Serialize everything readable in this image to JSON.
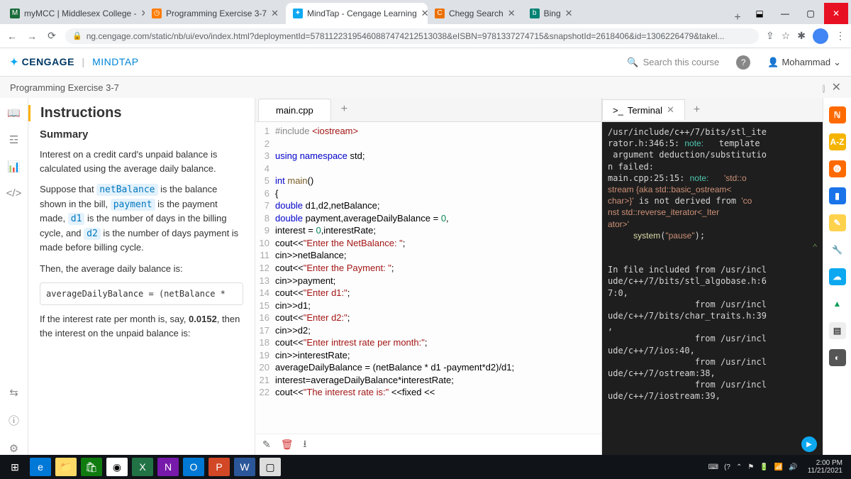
{
  "browser": {
    "tabs": [
      {
        "fav": "M",
        "favbg": "#1a6b3a",
        "label": "myMCC | Middlesex College - "
      },
      {
        "fav": "◷",
        "favbg": "#ff7b00",
        "label": "Programming Exercise 3-7"
      },
      {
        "fav": "✦",
        "favbg": "#0da8f0",
        "label": "MindTap - Cengage Learning",
        "active": true
      },
      {
        "fav": "C",
        "favbg": "#eb7100",
        "label": "Chegg Search"
      },
      {
        "fav": "b",
        "favbg": "#008373",
        "label": "Bing"
      }
    ],
    "url": "ng.cengage.com/static/nb/ui/evo/index.html?deploymentId=57811223195460887474212513038&eISBN=9781337274715&snapshotId=2618406&id=1306226479&takel..."
  },
  "cengage": {
    "brand1": "CENGAGE",
    "brand2": "MINDTAP",
    "search_placeholder": "Search this course",
    "user": "Mohammad"
  },
  "subheader": {
    "title": "Programming Exercise 3-7"
  },
  "instructions": {
    "title": "Instructions",
    "summary_h": "Summary",
    "p1": "Interest on a credit card's unpaid balance is calculated using the average daily balance.",
    "p2a": "Suppose that ",
    "p2b": " is the balance shown in the bill, ",
    "p2c": " is the payment made, ",
    "p2d": " is the number of days in the billing cycle, and ",
    "p2e": " is the number of days payment is made before billing cycle.",
    "code_net": "netBalance",
    "code_pay": "payment",
    "code_d1": "d1",
    "code_d2": "d2",
    "p3": "Then, the average daily balance is:",
    "box1": "averageDailyBalance = (netBalance *",
    "p4a": "If the interest rate per month is, say, ",
    "p4b": ", then the interest on the unpaid balance is:",
    "rate": "0.0152",
    "book_icon": "📖"
  },
  "editor": {
    "tab": "main.cpp",
    "lines": [
      {
        "n": 1,
        "html": "<span class='pp'>#include</span> <span class='str'>&lt;iostream&gt;</span>"
      },
      {
        "n": 2,
        "html": ""
      },
      {
        "n": 3,
        "html": "<span class='kw'>using</span> <span class='kw'>namespace</span> std;"
      },
      {
        "n": 4,
        "html": ""
      },
      {
        "n": 5,
        "html": "<span class='kw'>int</span> <span class='fn'>main</span>()"
      },
      {
        "n": 6,
        "html": "{"
      },
      {
        "n": 7,
        "html": "<span class='kw'>double</span> d1,d2,netBalance;"
      },
      {
        "n": 8,
        "html": "<span class='kw'>double</span> payment,averageDailyBalance = <span class='num'>0</span>,"
      },
      {
        "n": 9,
        "html": "interest = <span class='num'>0</span>,interestRate;"
      },
      {
        "n": 10,
        "html": "cout&lt;&lt;<span class='str'>\"Enter the NetBalance: \"</span>;"
      },
      {
        "n": 11,
        "html": "cin&gt;&gt;netBalance;"
      },
      {
        "n": 12,
        "html": "cout&lt;&lt;<span class='str'>\"Enter the Payment: \"</span>;"
      },
      {
        "n": 13,
        "html": "cin&gt;&gt;payment;"
      },
      {
        "n": 14,
        "html": "cout&lt;&lt;<span class='str'>\"Enter d1:\"</span>;"
      },
      {
        "n": 15,
        "html": "cin&gt;&gt;d1;"
      },
      {
        "n": 16,
        "html": "cout&lt;&lt;<span class='str'>\"Enter d2:\"</span>;"
      },
      {
        "n": 17,
        "html": "cin&gt;&gt;d2;"
      },
      {
        "n": 18,
        "html": "cout&lt;&lt;<span class='str'>\"Enter intrest rate per month:\"</span>;"
      },
      {
        "n": 19,
        "html": "cin&gt;&gt;interestRate;"
      },
      {
        "n": 20,
        "html": "averageDailyBalance = (netBalance * d1 -payment*d2)/d1;"
      },
      {
        "n": 21,
        "html": "interest=averageDailyBalance*interestRate;"
      },
      {
        "n": 22,
        "html": "cout&lt;&lt;<span class='str'>\"The interest rate is:\"</span> &lt;&lt;fixed &lt;&lt;"
      }
    ]
  },
  "terminal": {
    "tab": "Terminal",
    "body": "/usr/include/c++/7/bits/stl_ite\nrator.h:346:5: <span class='note'>note:</span>   template\n argument deduction/substitutio\nn failed:\nmain.cpp:25:15: <span class='note'>note:</span>   <span class='str2'>'std::o\nstream {aka std::basic_ostream&lt;\nchar&gt;}'</span> is not derived from <span class='str2'>'co\nnst std::reverse_iterator&lt;_Iter\nator&gt;'</span>\n     <span class='fn2'>system</span>(<span class='str2'>\"pause\"</span>);\n<span class='scroll-up'>^</span>\nIn file included from /usr/incl\nude/c++/7/bits/stl_algobase.h:6\n7:0,\n                 from /usr/incl\nude/c++/7/bits/char_traits.h:39\n,\n                 from /usr/incl\nude/c++/7/ios:40,\n                 from /usr/incl\nude/c++/7/ostream:38,\n                 from /usr/incl\nude/c++/7/iostream:39,"
  },
  "rightbar": [
    {
      "bg": "#ff6a00",
      "txt": "ℕ"
    },
    {
      "bg": "#f5b400",
      "txt": "A-Z"
    },
    {
      "bg": "#ff6a00",
      "txt": "➏"
    },
    {
      "bg": "#1a73e8",
      "txt": "▮"
    },
    {
      "bg": "#ffd24d",
      "txt": "✎"
    },
    {
      "bg": "#ffffff",
      "txt": "🔧",
      "fg": "#333"
    },
    {
      "bg": "#0da8f0",
      "txt": "☁"
    },
    {
      "bg": "#ffffff",
      "txt": "▲",
      "fg": "#0f9d58"
    },
    {
      "bg": "#eeeeee",
      "txt": "▤",
      "fg": "#444"
    },
    {
      "bg": "#555555",
      "txt": "◐"
    }
  ],
  "taskbar": {
    "time": "2:00 PM",
    "date": "11/21/2021"
  }
}
